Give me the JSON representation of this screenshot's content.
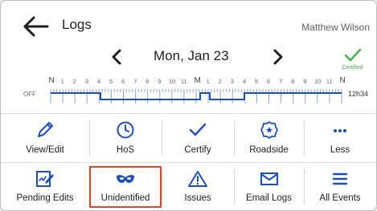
{
  "header": {
    "title": "Logs",
    "user": "Matthew Wilson"
  },
  "datebar": {
    "date": "Mon, Jan 23",
    "certified_label": "Certified"
  },
  "log_chart": {
    "hour_labels": [
      "N",
      "1",
      "2",
      "3",
      "4",
      "5",
      "6",
      "7",
      "8",
      "9",
      "10",
      "11",
      "M",
      "1",
      "2",
      "3",
      "4",
      "5",
      "6",
      "7",
      "8",
      "9",
      "10",
      "11",
      "N"
    ],
    "row_label": "OFF",
    "total": "12h34"
  },
  "actions_row1": [
    {
      "label": "View/Edit",
      "icon": "pencil-icon"
    },
    {
      "label": "HoS",
      "icon": "clock-icon"
    },
    {
      "label": "Certify",
      "icon": "checkmark-icon"
    },
    {
      "label": "Roadside",
      "icon": "badge-icon"
    },
    {
      "label": "Less",
      "icon": "more-dots-icon"
    }
  ],
  "actions_row2": [
    {
      "label": "Pending Edits",
      "icon": "pending-edits-icon"
    },
    {
      "label": "Unidentified",
      "icon": "mask-icon"
    },
    {
      "label": "Issues",
      "icon": "warning-icon"
    },
    {
      "label": "Email Logs",
      "icon": "envelope-icon"
    },
    {
      "label": "All Events",
      "icon": "list-icon"
    }
  ],
  "colors": {
    "accent_blue": "#1f4fb3",
    "certified_green": "#4caf50",
    "highlight_red": "#e0452d"
  }
}
